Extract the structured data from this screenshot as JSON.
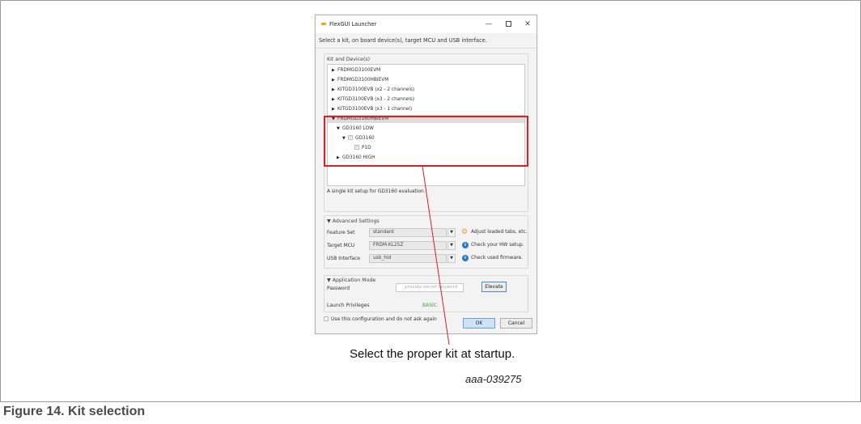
{
  "window": {
    "title": "FlexGUI Launcher",
    "minimize": "—",
    "close": "✕",
    "instruction": "Select a kit, on board device(s), target MCU and USB interface."
  },
  "kits": {
    "group_label": "Kit and Device(s)",
    "items": [
      {
        "arrow": "▶",
        "label": "FRDMGD3100EVM"
      },
      {
        "arrow": "▶",
        "label": "FRDMGD3100HBIEVM"
      },
      {
        "arrow": "▶",
        "label": "KITGD3100EVB (x2 - 2 channels)"
      },
      {
        "arrow": "▶",
        "label": "KITGD3100EVB (x3 - 2 channels)"
      },
      {
        "arrow": "▶",
        "label": "KITGD3100EVB (x3 - 1 channel)"
      },
      {
        "arrow": "▼",
        "label": "FRDMGD3160HBIEVM"
      },
      {
        "arrow": "▼",
        "label": "GD3160 LOW"
      },
      {
        "arrow": "▼",
        "check": "✓",
        "label": "GD3160"
      },
      {
        "check": "✓",
        "label": "P1D"
      },
      {
        "arrow": "▶",
        "label": "GD3160 HIGH"
      }
    ],
    "description": "A single kit setup for GD3160 evaluation."
  },
  "advanced": {
    "group_label": "Advanced Settings",
    "arrow": "▼",
    "rows": [
      {
        "label": "Feature Set",
        "value": "standard",
        "hint": "Adjust loaded tabs, etc.",
        "icon": "gear-icon"
      },
      {
        "label": "Target MCU",
        "value": "FRDM-KL25Z",
        "hint": "Check your HW setup.",
        "icon": "info-icon"
      },
      {
        "label": "USB Interface",
        "value": "usb_hid",
        "hint": "Check used firmware.",
        "icon": "info-icon"
      }
    ],
    "dropdown_arrow": "▼",
    "info_glyph": "i",
    "gear_glyph": "⚙"
  },
  "mode": {
    "group_label": "Application Mode",
    "arrow": "▼",
    "password_label": "Password",
    "password_placeholder": "provide secret keyword",
    "elevate_label": "Elevate",
    "privileges_label": "Launch Privileges",
    "privileges_value": "BASIC"
  },
  "remember": {
    "label": "Use this configuration and do not ask again"
  },
  "buttons": {
    "ok": "OK",
    "cancel": "Cancel"
  },
  "annotation": {
    "callout": "Select the proper kit at startup.",
    "figure_id": "aaa-039275"
  },
  "caption": "Figure 14.  Kit selection",
  "colors": {
    "highlight": "#d81f2a",
    "selection": "#dcdcdc",
    "basic_status": "#3c9a3c",
    "info_icon": "#2b78c4"
  }
}
